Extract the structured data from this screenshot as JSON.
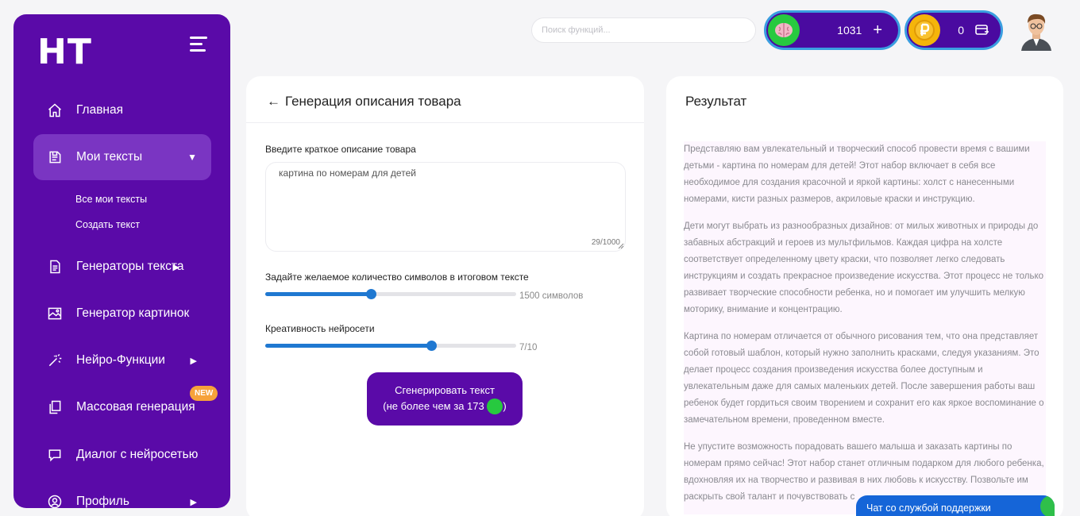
{
  "logo": "HT",
  "sidebar": {
    "items": [
      {
        "label": "Главная",
        "icon": "home-icon"
      },
      {
        "label": "Мои тексты",
        "icon": "document-icon"
      },
      {
        "label": "Генераторы текста",
        "icon": "file-text-icon"
      },
      {
        "label": "Генератор картинок",
        "icon": "image-icon"
      },
      {
        "label": "Нейро-Функции",
        "icon": "magic-wand-icon"
      },
      {
        "label": "Массовая генерация",
        "icon": "copy-icon"
      },
      {
        "label": "Диалог с нейросетью",
        "icon": "chat-icon"
      },
      {
        "label": "Профиль",
        "icon": "user-icon"
      }
    ],
    "sub_items": [
      "Все мои тексты",
      "Создать текст"
    ],
    "new_badge": "NEW"
  },
  "header": {
    "search_placeholder": "Поиск функций...",
    "brain_balance": "1031",
    "brain_plus": "+",
    "coin_balance": "0",
    "colors": {
      "brain": "#27c93f",
      "coin": "#f5b50a",
      "pill": "#4a0aa0",
      "pill_border": "#3a9ee0"
    }
  },
  "form": {
    "title": "Генерация описания товара",
    "back_arrow": "←",
    "description_label": "Введите краткое описание товара",
    "description_value": "картина по номерам для детей",
    "char_counter": "29/1000",
    "length_label": "Задайте желаемое количество символов в итоговом тексте",
    "length_value": "1500 символов",
    "length_fraction": 0.42,
    "creativity_label": "Креативность нейросети",
    "creativity_value": "7/10",
    "creativity_fraction": 0.66,
    "generate_line1": "Сгенерировать текст",
    "generate_line2": "(не более чем за 173",
    "generate_close": ")"
  },
  "result": {
    "title": "Результат",
    "paragraphs": [
      "Представляю вам увлекательный и творческий способ провести время с вашими детьми - картина по номерам для детей! Этот набор включает в себя все необходимое для создания красочной и яркой картины: холст с нанесенными номерами, кисти разных размеров, акриловые краски и инструкцию.",
      "Дети могут выбрать из разнообразных дизайнов: от милых животных и природы до забавных абстракций и героев из мультфильмов. Каждая цифра на холсте соответствует определенному цвету краски, что позволяет легко следовать инструкциям и создать прекрасное произведение искусства. Этот процесс не только развивает творческие способности ребенка, но и помогает им улучшить мелкую моторику, внимание и концентрацию.",
      "Картина по номерам отличается от обычного рисования тем, что она представляет собой готовый шаблон, который нужно заполнить красками, следуя указаниям. Это делает процесс создания произведения искусства более доступным и увлекательным даже для самых маленьких детей. После завершения работы ваш ребенок будет гордиться своим творением и сохранит его как яркое воспоминание о замечательном времени, проведенном вместе.",
      "Не упустите возможность порадовать вашего малыша и заказать картины по номерам прямо сейчас! Этот набор станет отличным подарком для любого ребенка, вдохновляя их на творчество и развивая в них любовь к искусству. Позвольте им раскрыть свой талант и почувствовать с"
    ]
  },
  "chat_widget": "Чат со службой поддержки"
}
